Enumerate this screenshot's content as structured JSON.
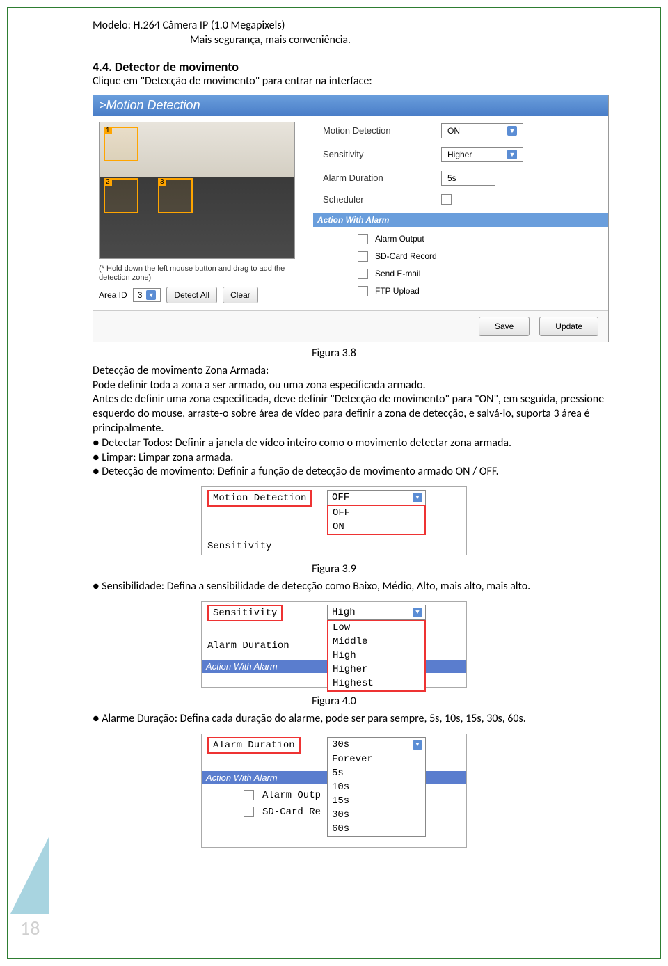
{
  "header": {
    "model_line": "Modelo: H.264 Câmera IP (1.0 Megapixels)",
    "tagline": "Mais segurança, mais conveniência."
  },
  "section": {
    "title": "4.4. Detector de movimento",
    "intro": "Clique em \"Detecção de movimento\" para entrar na interface:"
  },
  "screenshot1": {
    "title": ">Motion Detection",
    "zones": [
      "1",
      "2",
      "3"
    ],
    "hold_note": "(* Hold down the left mouse button and drag to add the detection zone)",
    "area_id_label": "Area ID",
    "area_id_value": "3",
    "detect_all": "Detect All",
    "clear": "Clear",
    "right": {
      "motion_detection_label": "Motion Detection",
      "motion_detection_value": "ON",
      "sensitivity_label": "Sensitivity",
      "sensitivity_value": "Higher",
      "alarm_duration_label": "Alarm Duration",
      "alarm_duration_value": "5s",
      "scheduler_label": "Scheduler",
      "action_header": "Action With Alarm",
      "alarm_output": "Alarm Output",
      "sd_card": "SD-Card Record",
      "send_email": "Send E-mail",
      "ftp_upload": "FTP Upload",
      "save_btn": "Save",
      "update_btn": "Update"
    }
  },
  "captions": {
    "fig38": "Figura 3.8",
    "fig39": "Figura 3.9",
    "fig40": "Figura 4.0"
  },
  "para": {
    "zona_title": "Detecção de movimento Zona Armada:",
    "zona_line1": "Pode definir toda a zona a ser armado, ou uma zona especificada armado.",
    "zona_line2": "Antes de definir uma zona especificada, deve definir \"Detecção de movimento\" para \"ON\", em seguida, pressione esquerdo do mouse, arraste-o sobre área de vídeo para definir a zona de detecção, e salvá-lo, suporta 3 área é principalmente.",
    "bul1": "● Detectar Todos: Definir a janela de vídeo inteiro como o movimento detectar zona armada.",
    "bul2": "● Limpar: Limpar zona armada.",
    "bul3": "● Detecção de movimento: Definir a função de detecção de movimento armado ON / OFF.",
    "bul4": "● Sensibilidade: Defina a sensibilidade de detecção como Baixo, Médio, Alto, mais alto, mais alto.",
    "bul5": "● Alarme Duração: Defina cada duração do alarme, pode ser para sempre, 5s, 10s, 15s, 30s, 60s."
  },
  "shot2": {
    "motion_label": "Motion Detection",
    "sensitivity_label": "Sensitivity",
    "off": "OFF",
    "options": [
      "OFF",
      "ON"
    ]
  },
  "shot3": {
    "sensitivity_label": "Sensitivity",
    "alarm_label": "Alarm Duration",
    "action_header": "Action With Alarm",
    "value": "High",
    "options": [
      "Low",
      "Middle",
      "High",
      "Higher",
      "Highest"
    ]
  },
  "shot4": {
    "alarm_label": "Alarm Duration",
    "action_header": "Action With Alarm",
    "alarm_out": "Alarm Outp",
    "sd_card": "SD-Card Re",
    "value": "30s",
    "options": [
      "Forever",
      "5s",
      "10s",
      "15s",
      "30s",
      "60s"
    ]
  },
  "page_number": "18"
}
